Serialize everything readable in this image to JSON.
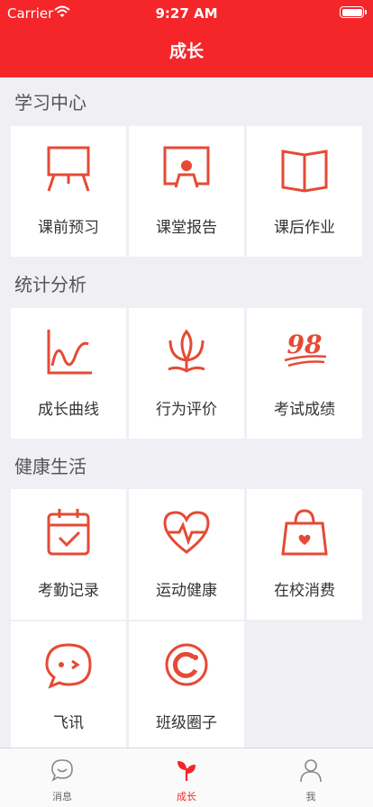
{
  "status_bar": {
    "carrier": "Carrier",
    "time": "9:27 AM"
  },
  "nav": {
    "title": "成长"
  },
  "colors": {
    "accent": "#f4262a",
    "icon": "#e64a35",
    "background": "#efeff4"
  },
  "sections": [
    {
      "title": "学习中心",
      "items": [
        {
          "label": "课前预习",
          "icon": "easel-icon"
        },
        {
          "label": "课堂报告",
          "icon": "classroom-report-icon"
        },
        {
          "label": "课后作业",
          "icon": "book-icon"
        }
      ]
    },
    {
      "title": "统计分析",
      "items": [
        {
          "label": "成长曲线",
          "icon": "growth-curve-icon"
        },
        {
          "label": "行为评价",
          "icon": "lotus-icon"
        },
        {
          "label": "考试成绩",
          "icon": "score-98-icon",
          "icon_text": "98"
        }
      ]
    },
    {
      "title": "健康生活",
      "items": [
        {
          "label": "考勤记录",
          "icon": "calendar-check-icon"
        },
        {
          "label": "运动健康",
          "icon": "heart-pulse-icon"
        },
        {
          "label": "在校消费",
          "icon": "shopping-bag-icon"
        },
        {
          "label": "飞讯",
          "icon": "chat-bubble-icon"
        },
        {
          "label": "班级圈子",
          "icon": "circle-icon"
        }
      ]
    }
  ],
  "tabbar": [
    {
      "label": "消息",
      "icon": "message-icon",
      "active": false
    },
    {
      "label": "成长",
      "icon": "sprout-icon",
      "active": true
    },
    {
      "label": "我",
      "icon": "person-icon",
      "active": false
    }
  ]
}
